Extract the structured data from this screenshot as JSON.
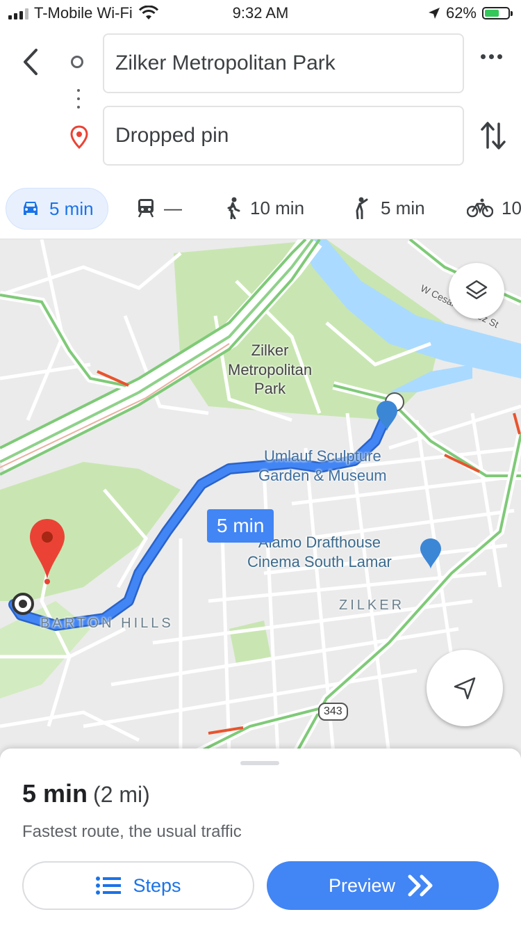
{
  "status_bar": {
    "carrier": "T-Mobile Wi-Fi",
    "time": "9:32 AM",
    "battery": "62%",
    "battery_level": 0.62
  },
  "header": {
    "origin": "Zilker Metropolitan Park",
    "destination": "Dropped pin"
  },
  "modes": [
    {
      "name": "drive",
      "label": "5 min",
      "active": true
    },
    {
      "name": "transit",
      "label": "—"
    },
    {
      "name": "walk",
      "label": "10 min"
    },
    {
      "name": "rideshare",
      "label": "5 min"
    },
    {
      "name": "bike",
      "label": "10"
    }
  ],
  "map": {
    "labels": {
      "park": "Zilker\nMetropolitan\nPark",
      "umlauf": "Umlauf Sculpture\nGarden & Museum",
      "alamo": "Alamo Drafthouse\nCinema South Lamar",
      "zilker": "ZILKER",
      "barton": "BARTON HILLS",
      "cesar": "W Cesar Chavez St",
      "highway": "343"
    },
    "route_time": "5 min"
  },
  "sheet": {
    "duration": "5 min",
    "distance": "(2 mi)",
    "description": "Fastest route, the usual traffic",
    "steps_label": "Steps",
    "preview_label": "Preview"
  },
  "colors": {
    "accent": "#1a73e8",
    "route": "#4285f4",
    "pin": "#ea4335",
    "park": "#c9e6b2",
    "water": "#aadaff"
  }
}
